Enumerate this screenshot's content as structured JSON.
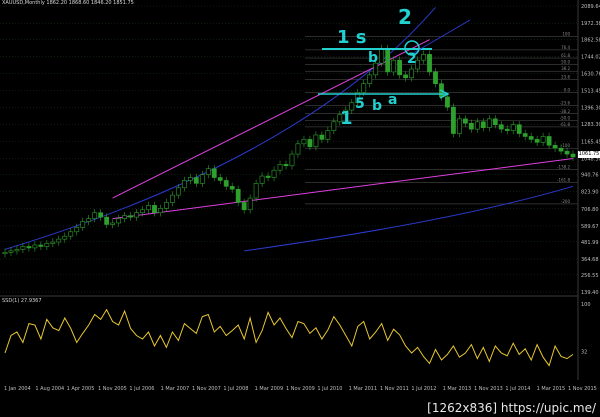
{
  "header": {
    "price_info": "XAUUSD,Monthly  1862.20 1868.60 1846.20 1851.75",
    "oscillator_info": "SSD(1) 27.9367"
  },
  "current_price_label": "1061.75",
  "hand_labels": {
    "top_left": "1 s",
    "top_right": "2",
    "wave_b": "b",
    "circle_2": "2",
    "bottom_1": "1",
    "bottom_5": "5",
    "bottom_b": "b",
    "bottom_a": "a"
  },
  "watermark": "[1262x836] https://upic.me/",
  "colors": {
    "background": "#000000",
    "grid": "#1a3a1a",
    "candle": "#2ea02e",
    "trend_channel": "#e040e0",
    "regression": "#2a3acc",
    "fib_line": "#5a5a5a",
    "annotation": "#22d0d0",
    "oscillator": "#e8c830"
  },
  "chart_data": [
    {
      "type": "candlestick",
      "title": "XAUUSD,Monthly",
      "y_axis_ticks": [
        2089.64,
        1972.38,
        1862.58,
        1744.02,
        1630.76,
        1513.45,
        1396.3,
        1283.3,
        1165.45,
        1048.3,
        940.76,
        823.9,
        706.8,
        589.67,
        481.99,
        364.68,
        256.55,
        139.4
      ],
      "x_axis_ticks": [
        "1 Jan 2004",
        "1 Aug 2004",
        "1 Apr 2005",
        "1 Nov 2005",
        "1 Jul 2006",
        "1 Mar 2007",
        "1 Nov 2007",
        "1 Jul 2008",
        "1 Mar 2009",
        "1 Nov 2009",
        "1 Jul 2010",
        "1 Mar 2011",
        "1 Nov 2011",
        "1 Jul 2012",
        "1 Mar 2013",
        "1 Nov 2013",
        "1 Jul 2014",
        "1 Mar 2015",
        "1 Nov 2015"
      ],
      "ylim": [
        139.4,
        2089.64
      ],
      "fib_levels": [
        "100",
        "76.4",
        "61.8",
        "50.0",
        "38.2",
        "23.6",
        "0.0",
        "-23.6",
        "-38.2",
        "-50.0",
        "-61.8",
        "-100",
        "-138.2",
        "-161.8",
        "-200"
      ],
      "close_prices": [
        410,
        420,
        430,
        450,
        440,
        460,
        450,
        470,
        480,
        500,
        520,
        550,
        580,
        620,
        640,
        680,
        650,
        600,
        610,
        640,
        660,
        650,
        680,
        700,
        730,
        680,
        710,
        750,
        800,
        850,
        900,
        920,
        880,
        940,
        980,
        920,
        900,
        860,
        840,
        750,
        700,
        780,
        880,
        930,
        920,
        970,
        1010,
        1000,
        1080,
        1150,
        1180,
        1130,
        1210,
        1180,
        1240,
        1300,
        1350,
        1380,
        1430,
        1500,
        1560,
        1620,
        1700,
        1800,
        1640,
        1720,
        1620,
        1600,
        1660,
        1720,
        1760,
        1640,
        1560,
        1470,
        1400,
        1220,
        1320,
        1290,
        1250,
        1300,
        1260,
        1320,
        1280,
        1250,
        1240,
        1280,
        1220,
        1200,
        1180,
        1160,
        1200,
        1140,
        1120,
        1100,
        1080,
        1060
      ],
      "current_price": 1061.75
    },
    {
      "type": "line",
      "title": "SSD(1) 27.9367",
      "y_axis_ticks": [
        100,
        32
      ],
      "ylim": [
        0,
        100
      ],
      "values": [
        30,
        55,
        60,
        45,
        72,
        70,
        50,
        78,
        66,
        62,
        80,
        65,
        45,
        58,
        70,
        85,
        78,
        92,
        75,
        70,
        90,
        65,
        55,
        50,
        60,
        40,
        55,
        38,
        60,
        48,
        72,
        65,
        58,
        82,
        85,
        60,
        68,
        55,
        62,
        70,
        50,
        80,
        45,
        62,
        88,
        70,
        80,
        65,
        52,
        75,
        72,
        58,
        66,
        50,
        63,
        82,
        70,
        55,
        40,
        68,
        75,
        50,
        60,
        72,
        48,
        64,
        56,
        40,
        30,
        38,
        25,
        15,
        35,
        20,
        28,
        40,
        24,
        30,
        42,
        22,
        38,
        18,
        40,
        30,
        26,
        44,
        28,
        36,
        20,
        42,
        24,
        12,
        40,
        25,
        22,
        28
      ]
    }
  ]
}
